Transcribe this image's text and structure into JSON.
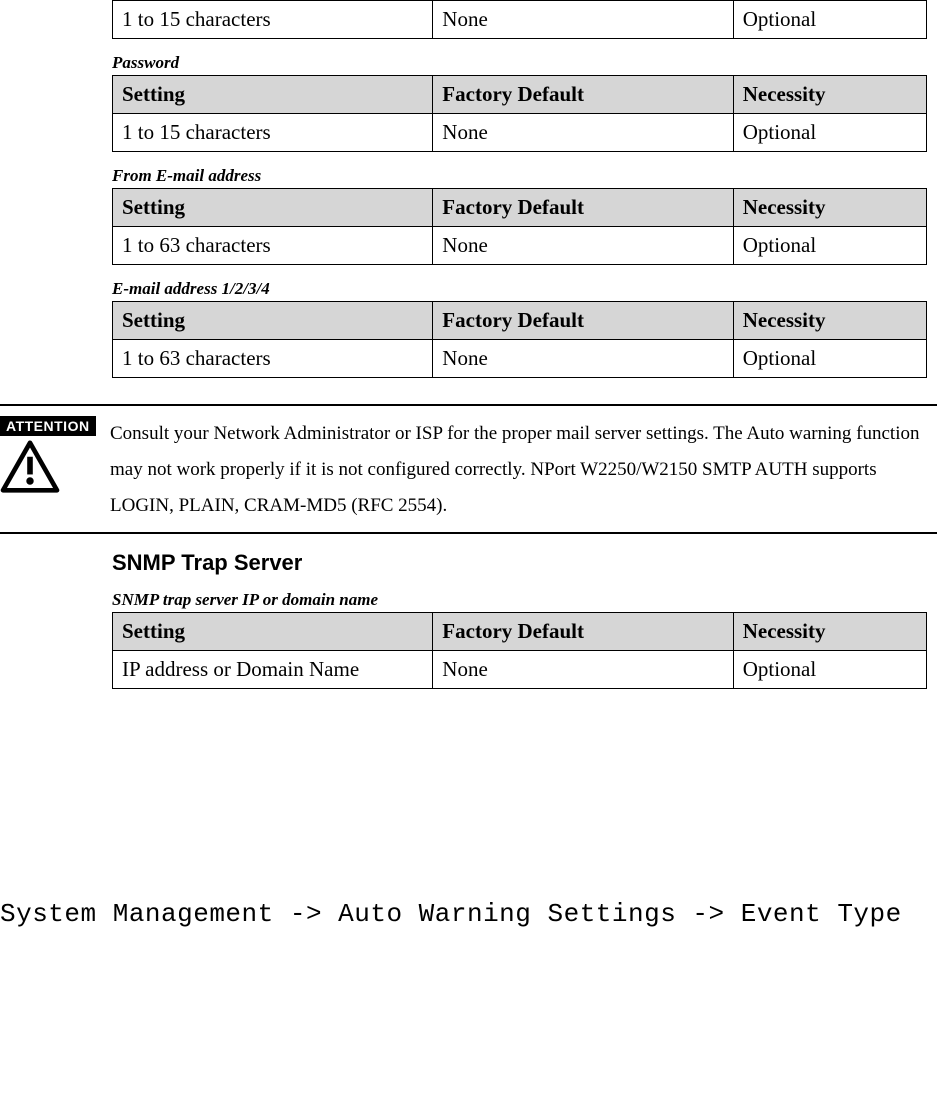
{
  "tables": {
    "top_orphan": {
      "rows": [
        {
          "setting": "1 to 15 characters",
          "default": "None",
          "necessity": "Optional"
        }
      ]
    },
    "password": {
      "title": "Password",
      "headers": {
        "setting": "Setting",
        "default": "Factory Default",
        "necessity": "Necessity"
      },
      "rows": [
        {
          "setting": "1 to 15 characters",
          "default": "None",
          "necessity": "Optional"
        }
      ]
    },
    "from_email": {
      "title": "From E-mail address",
      "headers": {
        "setting": "Setting",
        "default": "Factory Default",
        "necessity": "Necessity"
      },
      "rows": [
        {
          "setting": "1 to 63 characters",
          "default": "None",
          "necessity": "Optional"
        }
      ]
    },
    "email_1234": {
      "title": "E-mail address 1/2/3/4",
      "headers": {
        "setting": "Setting",
        "default": "Factory Default",
        "necessity": "Necessity"
      },
      "rows": [
        {
          "setting": "1 to 63 characters",
          "default": "None",
          "necessity": "Optional"
        }
      ]
    },
    "snmp_trap": {
      "title": "SNMP trap server IP or domain name",
      "headers": {
        "setting": "Setting",
        "default": "Factory Default",
        "necessity": "Necessity"
      },
      "rows": [
        {
          "setting": "IP address or Domain Name",
          "default": "None",
          "necessity": "Optional"
        }
      ]
    }
  },
  "attention": {
    "badge": "ATTENTION",
    "text": "Consult your Network Administrator or ISP for the proper mail server settings. The Auto warning function may not work properly if it is not configured correctly. NPort W2250/W2150 SMTP AUTH supports LOGIN, PLAIN, CRAM-MD5 (RFC 2554)."
  },
  "snmp_section_heading": "SNMP Trap Server",
  "breadcrumb": "System Management -> Auto Warning Settings -> Event Type"
}
